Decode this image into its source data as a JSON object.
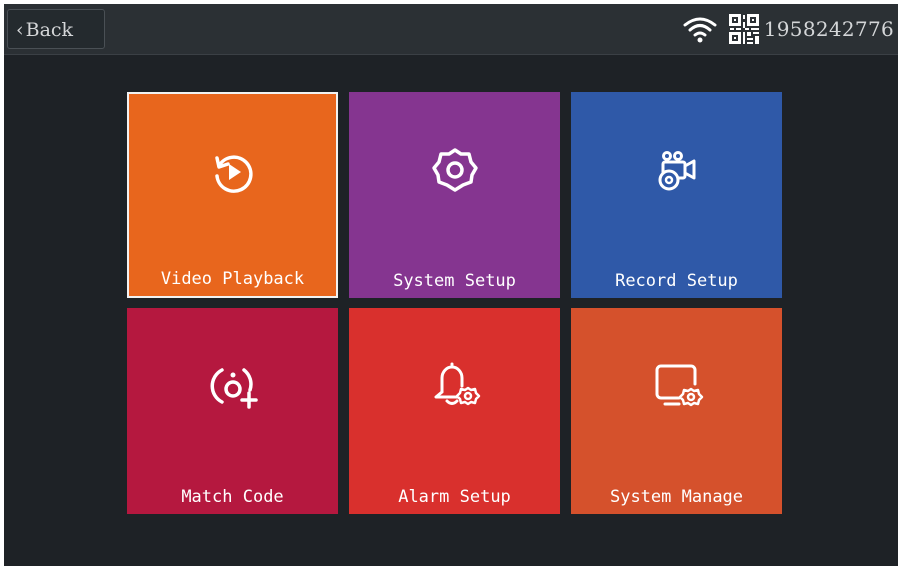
{
  "header": {
    "back_label": "Back",
    "device_id": "1958242776"
  },
  "icons": {
    "wifi": "wifi-icon",
    "qr": "qr-code-icon"
  },
  "menu": {
    "tiles": [
      {
        "label": "Video Playback",
        "color": "#e8661d",
        "icon": "replay-icon",
        "selected": true
      },
      {
        "label": "System Setup",
        "color": "#853590",
        "icon": "gear-icon",
        "selected": false
      },
      {
        "label": "Record Setup",
        "color": "#2f59a8",
        "icon": "camera-gear-icon",
        "selected": false
      },
      {
        "label": "Match Code",
        "color": "#b5183f",
        "icon": "pair-code-icon",
        "selected": false
      },
      {
        "label": "Alarm Setup",
        "color": "#d9302d",
        "icon": "bell-gear-icon",
        "selected": false
      },
      {
        "label": "System Manage",
        "color": "#d5512c",
        "icon": "monitor-gear-icon",
        "selected": false
      }
    ]
  }
}
